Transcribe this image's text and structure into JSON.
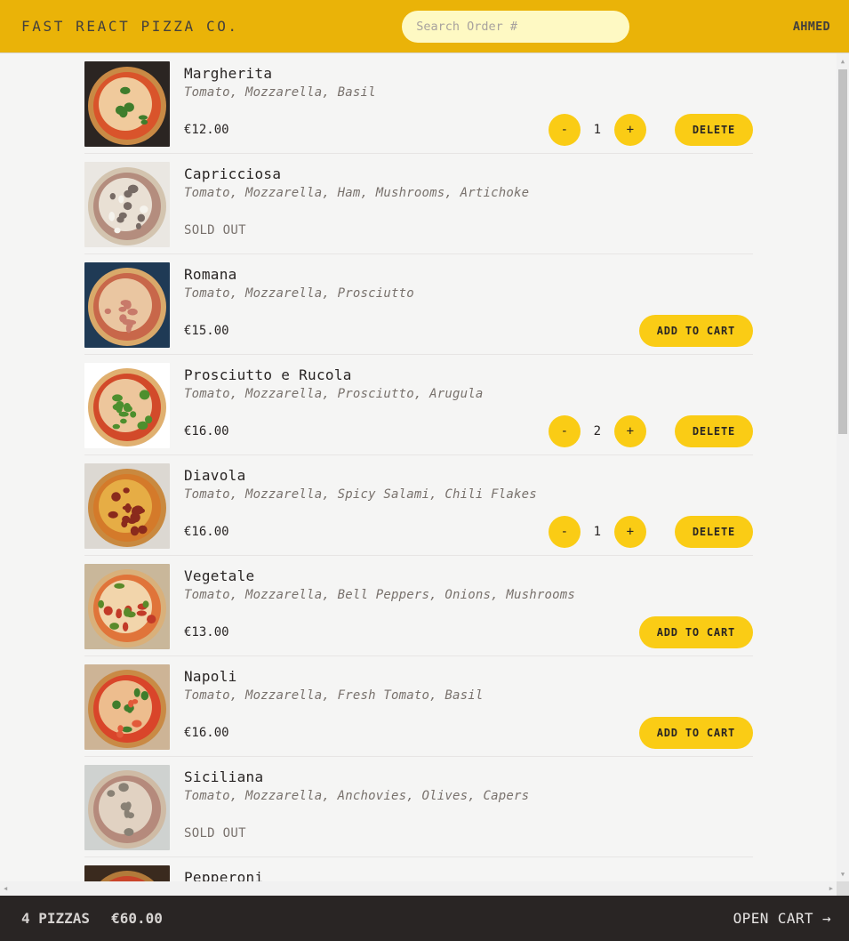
{
  "header": {
    "logo": "Fast React Pizza Co.",
    "search_placeholder": "Search Order #",
    "username": "AHMED"
  },
  "menu": [
    {
      "name": "Margherita",
      "ingredients": "Tomato, Mozzarella, Basil",
      "price": "€12.00",
      "sold_out": false,
      "quantity": "1",
      "action": "DELETE",
      "img": "margherita"
    },
    {
      "name": "Capricciosa",
      "ingredients": "Tomato, Mozzarella, Ham, Mushrooms, Artichoke",
      "price": "",
      "sold_out": true,
      "status": "SOLD OUT",
      "img": "capricciosa"
    },
    {
      "name": "Romana",
      "ingredients": "Tomato, Mozzarella, Prosciutto",
      "price": "€15.00",
      "sold_out": false,
      "action": "ADD TO CART",
      "img": "romana"
    },
    {
      "name": "Prosciutto e Rucola",
      "ingredients": "Tomato, Mozzarella, Prosciutto, Arugula",
      "price": "€16.00",
      "sold_out": false,
      "quantity": "2",
      "action": "DELETE",
      "img": "rucola"
    },
    {
      "name": "Diavola",
      "ingredients": "Tomato, Mozzarella, Spicy Salami, Chili Flakes",
      "price": "€16.00",
      "sold_out": false,
      "quantity": "1",
      "action": "DELETE",
      "img": "diavola"
    },
    {
      "name": "Vegetale",
      "ingredients": "Tomato, Mozzarella, Bell Peppers, Onions, Mushrooms",
      "price": "€13.00",
      "sold_out": false,
      "action": "ADD TO CART",
      "img": "vegetale"
    },
    {
      "name": "Napoli",
      "ingredients": "Tomato, Mozzarella, Fresh Tomato, Basil",
      "price": "€16.00",
      "sold_out": false,
      "action": "ADD TO CART",
      "img": "napoli"
    },
    {
      "name": "Siciliana",
      "ingredients": "Tomato, Mozzarella, Anchovies, Olives, Capers",
      "price": "",
      "sold_out": true,
      "status": "SOLD OUT",
      "img": "siciliana"
    },
    {
      "name": "Pepperoni",
      "ingredients": "",
      "price": "",
      "sold_out": false,
      "img": "pepperoni"
    }
  ],
  "quantity_buttons": {
    "decrease": "-",
    "increase": "+"
  },
  "cart": {
    "count": "4 pizzas",
    "total": "€60.00",
    "open_label": "Open cart →"
  },
  "colors": {
    "header_bg": "#eab308",
    "button_bg": "#facc15",
    "cart_bar_bg": "#292524",
    "page_bg": "#f5f5f4"
  }
}
